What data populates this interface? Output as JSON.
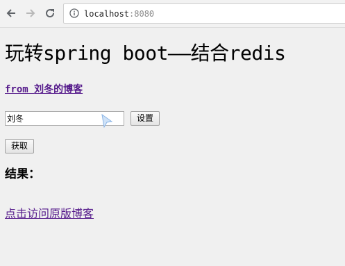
{
  "browser": {
    "back_icon": "arrow-left-icon",
    "forward_icon": "arrow-right-icon",
    "reload_icon": "reload-icon",
    "info_icon": "info-icon",
    "url_host": "localhost",
    "url_port": ":8080"
  },
  "page": {
    "title": "玩转spring boot——结合redis",
    "author_prefix": "from ",
    "author_name": "刘冬的博客",
    "key_input_value": "刘冬",
    "set_button_label": "设置",
    "get_button_label": "获取",
    "result_label": "结果：",
    "blog_link_text": "点击访问原版博客",
    "link_color": "#551a8b"
  }
}
